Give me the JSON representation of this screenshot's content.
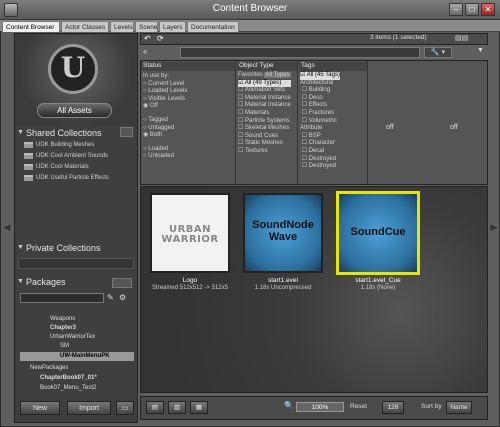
{
  "window": {
    "title": "Content Browser"
  },
  "tabs": [
    "Content Browser",
    "Actor Classes",
    "Levels",
    "Scene",
    "Layers",
    "Documentation"
  ],
  "left": {
    "all_assets": "All Assets",
    "shared_collections": {
      "title": "Shared Collections",
      "items": [
        "UDK Building Meshes",
        "UDK Cool Ambient Sounds",
        "UDK Cool Materials",
        "UDK Useful Particle Effects"
      ]
    },
    "private_collections": {
      "title": "Private Collections"
    },
    "packages": {
      "title": "Packages",
      "items": [
        "Weapons",
        "Chapter3",
        "UrbanWarriorTex",
        "SM",
        "UW-MainMenuPK",
        "NewPackages",
        "ChapterBook07_01*",
        "Book07_Menu_Test2"
      ]
    },
    "new_button": "New",
    "import_button": "Import"
  },
  "toolbar": {
    "item_count": "3 items (1 selected)"
  },
  "filters": {
    "status": {
      "title": "Status",
      "in_use_by": "In use by:",
      "options_a": [
        "Current Level",
        "Loaded Levels",
        "Visible Levels",
        "Off"
      ],
      "options_b": [
        "Tagged",
        "Untagged",
        "Both"
      ],
      "options_c": [
        "Loaded",
        "Unloaded"
      ]
    },
    "object_type": {
      "title": "Object Type",
      "favorites": "Favorites",
      "all_types": "All Types",
      "items": [
        "All (49 Types)",
        "Animation Sets",
        "Material Instance",
        "Material Instance",
        "Materials",
        "Particle Systems",
        "Skeletal Meshes",
        "Sound Cues",
        "Static Meshes",
        "Textures"
      ]
    },
    "tags": {
      "title": "Tags",
      "all": "All (45 Tags)",
      "groups": [
        "Architectural",
        "Attribute"
      ],
      "items_a": [
        "Building",
        "Deco",
        "Effects",
        "Fractures",
        "Volumetric"
      ],
      "items_b": [
        "BSP",
        "Character",
        "Decal",
        "Destroyed",
        "Destroyed"
      ]
    },
    "off_labels": [
      "off",
      "off"
    ]
  },
  "assets": [
    {
      "thumb_text": "URBAN WARRIOR",
      "name": "Logo",
      "info": "Streamed 512x512 -> 512x5",
      "selected": false
    },
    {
      "thumb_text": "SoundNode Wave",
      "name": "start1.evel",
      "info": "1.18s Uncompressed",
      "selected": false
    },
    {
      "thumb_text": "SoundCue",
      "name": "start1.evel_Cue",
      "info": "1.18s (None)",
      "selected": true
    }
  ],
  "statusbar": {
    "zoom": "100%",
    "reset": "Reset",
    "size": "128",
    "sort_by": "Sort by",
    "sort_value": "Name"
  },
  "colors": {
    "selection": "#e6e600",
    "sound_blue": "#3f8fc7"
  }
}
